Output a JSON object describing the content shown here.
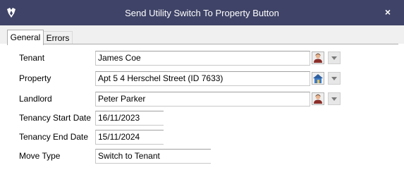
{
  "window": {
    "title": "Send Utility Switch To Property Button",
    "close_glyph": "×"
  },
  "tabs": [
    {
      "label": "General",
      "selected": true
    },
    {
      "label": "Errors",
      "selected": false
    }
  ],
  "form": {
    "tenant": {
      "label": "Tenant",
      "value": "James Coe"
    },
    "property": {
      "label": "Property",
      "value": "Apt 5 4 Herschel Street (ID 7633)"
    },
    "landlord": {
      "label": "Landlord",
      "value": "Peter Parker"
    },
    "tenancy_start": {
      "label": "Tenancy Start Date",
      "value": "16/11/2023"
    },
    "tenancy_end": {
      "label": "Tenancy End Date",
      "value": "15/11/2024"
    },
    "move_type": {
      "label": "Move Type",
      "value": "Switch to Tenant"
    }
  },
  "icons": {
    "app": "app-logo-icon",
    "person": "person-icon",
    "house": "house-icon",
    "dropdown": "chevron-down-icon"
  },
  "colors": {
    "titlebar": "#3f4367",
    "title_text": "#ffffff"
  }
}
